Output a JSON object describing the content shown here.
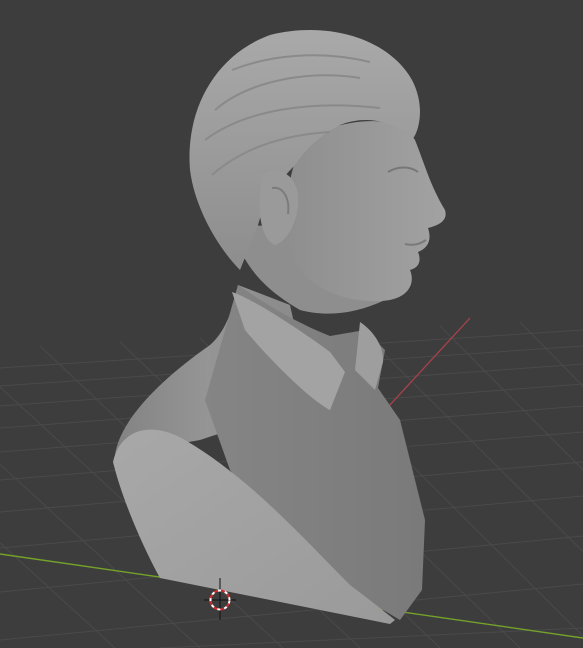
{
  "viewport": {
    "background": "#3d3d3d",
    "grid_color": "#4a4a4a",
    "x_axis_color": "#b0424a",
    "y_axis_color": "#74a22a",
    "object": "bust-sculpture",
    "object_color": "#9a9a9a",
    "cursor_icon": "3d-cursor-icon"
  }
}
